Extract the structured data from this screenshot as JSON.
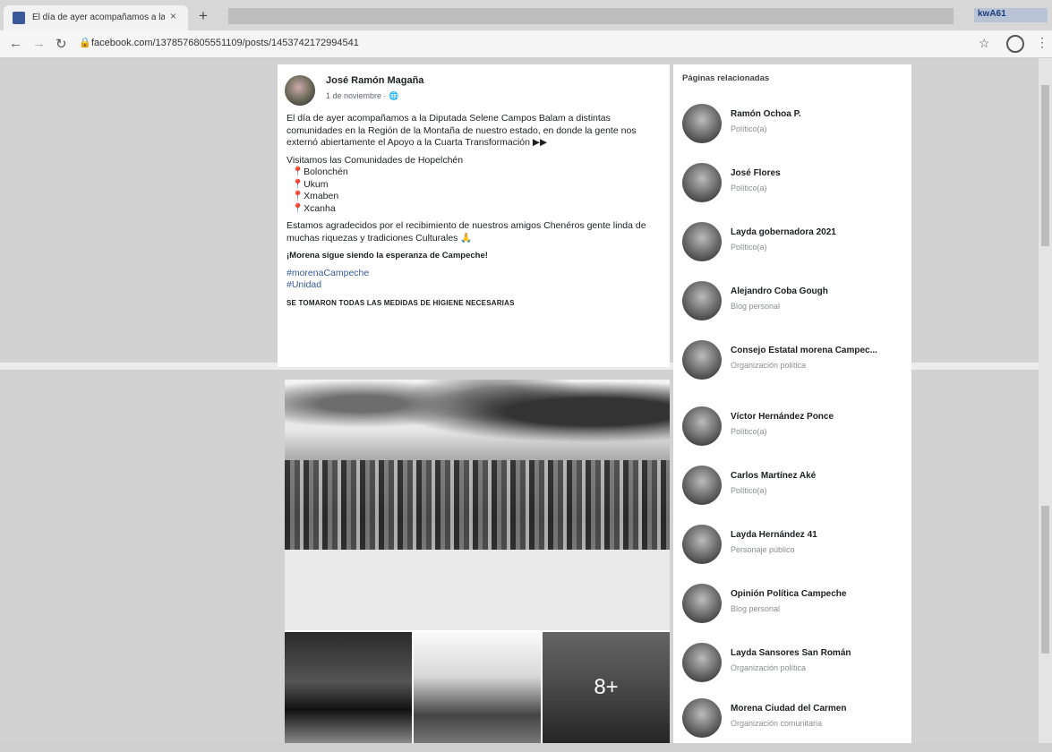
{
  "browser": {
    "tab_title": "El día de ayer acompañamos a la",
    "tab_close": "×",
    "new_tab": "+",
    "url": "facebook.com/1378576805551109/posts/1453742172994541",
    "right_badge": "kwA61"
  },
  "post": {
    "author": "José Ramón Magaña",
    "date": "1 de noviembre",
    "paragraph1": "El día de ayer acompañamos a la Diputada Selene Campos Balam a distintas comunidades en la Región de la Montaña de nuestro estado, en donde la gente nos externó abiertamente el Apoyo a la Cuarta Transformación ▶▶",
    "visit_intro": "Visitamos las Comunidades de Hopelchén",
    "communities": [
      "📍Bolonchén",
      "📍Ukum",
      "📍Xmaben",
      "📍Xcanha"
    ],
    "paragraph2": "Estamos agradecidos por el recibimiento de nuestros amigos Chenéros gente linda de muchas riquezas y tradiciones Culturales 🙏",
    "slogan": "¡Morena sigue siendo la esperanza de Campeche!",
    "hashtags": [
      "#morenaCampeche",
      "#Unidad"
    ],
    "note": "SE TOMARON TODAS LAS MEDIDAS DE HIGIENE NECESARIAS",
    "more_photos": "8+"
  },
  "related": {
    "title": "Páginas relacionadas",
    "items": [
      {
        "name": "Ramón Ochoa P.",
        "category": "Político(a)"
      },
      {
        "name": "José Flores",
        "category": "Político(a)"
      },
      {
        "name": "Layda gobernadora 2021",
        "category": "Político(a)"
      },
      {
        "name": "Alejandro Coba Gough",
        "category": "Blog personal"
      },
      {
        "name": "Consejo Estatal morena Campec...",
        "category": "Organización política"
      },
      {
        "name": "Víctor Hernández Ponce",
        "category": "Político(a)"
      },
      {
        "name": "Carlos Martínez Aké",
        "category": "Político(a)"
      },
      {
        "name": "Layda Hernández 41",
        "category": "Personaje público"
      },
      {
        "name": "Opinión Política Campeche",
        "category": "Blog personal"
      },
      {
        "name": "Layda Sansores San Román",
        "category": "Organización política"
      },
      {
        "name": "Morena Ciudad del Carmen",
        "category": "Organización comunitaria"
      }
    ]
  }
}
